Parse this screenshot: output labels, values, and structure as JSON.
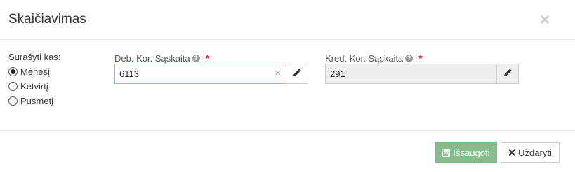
{
  "dialog": {
    "title": "Skaičiavimas",
    "close_symbol": "×"
  },
  "period": {
    "label": "Surašyti kas:",
    "options": [
      {
        "label": "Mėnesį",
        "checked": true
      },
      {
        "label": "Ketvirtį",
        "checked": false
      },
      {
        "label": "Pusmetį",
        "checked": false
      }
    ]
  },
  "debit_account": {
    "label": "Deb. Kor. Sąskaita",
    "help": "?",
    "required": "*",
    "value": "6113",
    "clear_symbol": "×",
    "edit_icon": "pencil-icon"
  },
  "credit_account": {
    "label": "Kred. Kor. Sąskaita",
    "help": "?",
    "required": "*",
    "value": "291",
    "edit_icon": "pencil-icon"
  },
  "footer": {
    "save_label": "Išsaugoti",
    "save_icon": "floppy-disk-icon",
    "close_label": "Uždaryti",
    "close_icon": "times-icon",
    "save_color": "#86bb8b"
  }
}
